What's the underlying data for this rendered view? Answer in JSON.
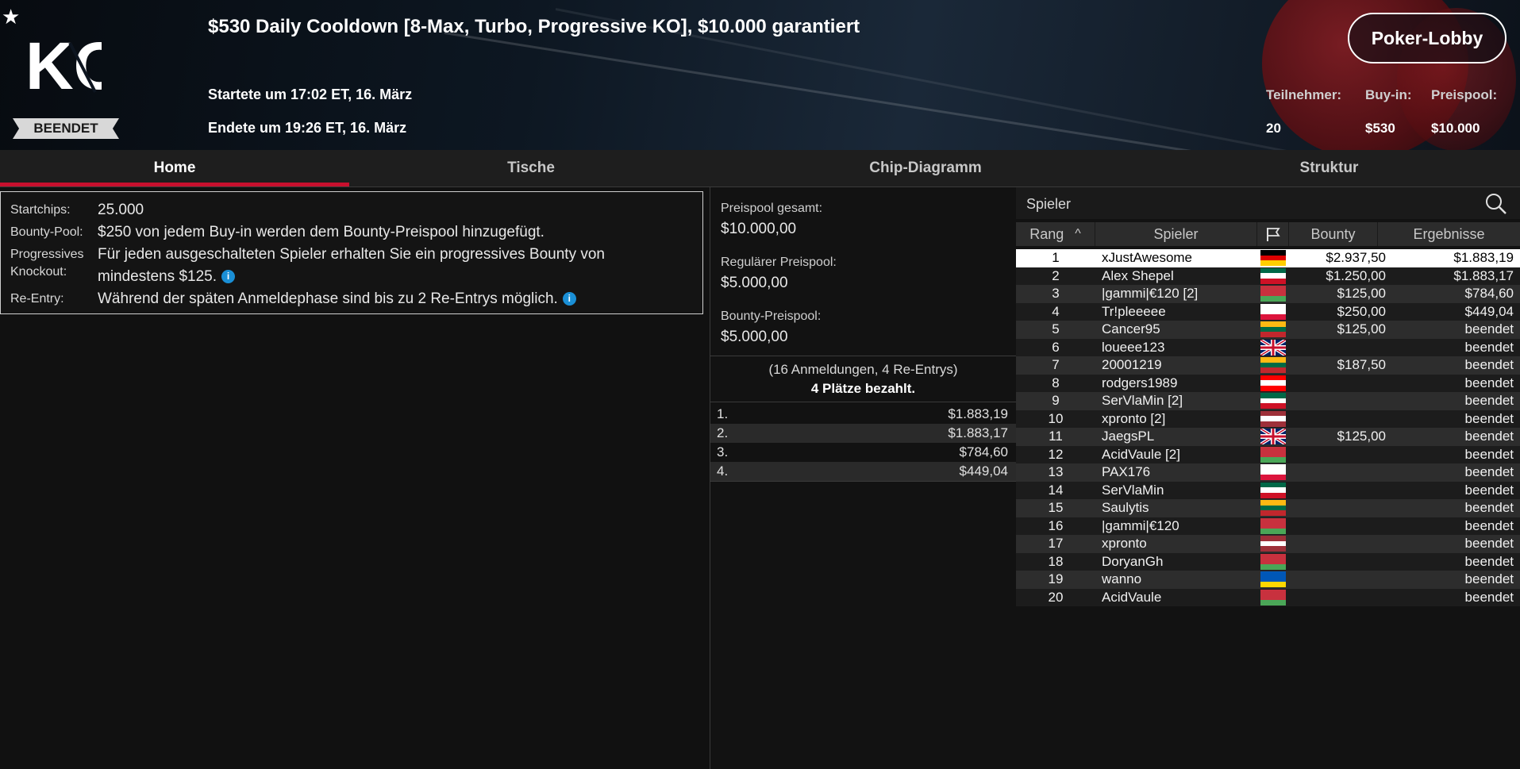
{
  "header": {
    "logo_text": "KO",
    "status_badge": "BEENDET",
    "title": "$530 Daily Cooldown [8-Max, Turbo, Progressive KO], $10.000 garantiert",
    "started": "Startete um 17:02 ET, 16. März",
    "ended": "Endete um 19:26 ET, 16. März",
    "lobby_button": "Poker-Lobby",
    "stats": [
      {
        "label": "Teilnehmer:",
        "value": "20"
      },
      {
        "label": "Buy-in:",
        "value": "$530"
      },
      {
        "label": "Preispool:",
        "value": "$10.000"
      }
    ]
  },
  "tabs": [
    "Home",
    "Tische",
    "Chip-Diagramm",
    "Struktur"
  ],
  "info": {
    "startchips_label": "Startchips:",
    "startchips_value": "25.000",
    "bounty_pool_label": "Bounty-Pool:",
    "bounty_pool_value": "$250 von jedem Buy-in werden dem Bounty-Preispool hinzugefügt.",
    "progressive_label_1": "Progressives",
    "progressive_label_2": "Knockout:",
    "progressive_value": "Für jeden ausgeschalteten Spieler erhalten Sie ein progressives Bounty von mindestens $125.",
    "reentry_label": "Re-Entry:",
    "reentry_value": "Während der späten Anmeldephase sind bis zu 2 Re-Entrys möglich."
  },
  "prizepool": {
    "total_label": "Preispool gesamt:",
    "total_value": "$10.000,00",
    "regular_label": "Regulärer Preispool:",
    "regular_value": "$5.000,00",
    "bounty_label": "Bounty-Preispool:",
    "bounty_value": "$5.000,00",
    "registrations": "(16 Anmeldungen, 4 Re-Entrys)",
    "paid_places": "4 Plätze bezahlt.",
    "payouts": [
      {
        "place": "1.",
        "amount": "$1.883,19"
      },
      {
        "place": "2.",
        "amount": "$1.883,17"
      },
      {
        "place": "3.",
        "amount": "$784,60"
      },
      {
        "place": "4.",
        "amount": "$449,04"
      }
    ]
  },
  "players": {
    "search_label": "Spieler",
    "columns": {
      "rank": "Rang",
      "player": "Spieler",
      "bounty": "Bounty",
      "result": "Ergebnisse"
    },
    "sort_indicator": "^",
    "rows": [
      {
        "rank": "1",
        "name": "xJustAwesome",
        "flag": "de",
        "bounty": "$2.937,50",
        "result": "$1.883,19"
      },
      {
        "rank": "2",
        "name": "Alex Shepel",
        "flag": "mx",
        "bounty": "$1.250,00",
        "result": "$1.883,17"
      },
      {
        "rank": "3",
        "name": "|gammi|€120 [2]",
        "flag": "by",
        "bounty": "$125,00",
        "result": "$784,60"
      },
      {
        "rank": "4",
        "name": "Tr!pleeeee",
        "flag": "pl",
        "bounty": "$250,00",
        "result": "$449,04"
      },
      {
        "rank": "5",
        "name": "Cancer95",
        "flag": "lt",
        "bounty": "$125,00",
        "result": "beendet"
      },
      {
        "rank": "6",
        "name": "loueee123",
        "flag": "gb",
        "bounty": "",
        "result": "beendet"
      },
      {
        "rank": "7",
        "name": "20001219",
        "flag": "lt",
        "bounty": "$187,50",
        "result": "beendet"
      },
      {
        "rank": "8",
        "name": "rodgers1989",
        "flag": "ca",
        "bounty": "",
        "result": "beendet"
      },
      {
        "rank": "9",
        "name": "SerVlaMin [2]",
        "flag": "mx",
        "bounty": "",
        "result": "beendet"
      },
      {
        "rank": "10",
        "name": "xpronto [2]",
        "flag": "lv",
        "bounty": "",
        "result": "beendet"
      },
      {
        "rank": "11",
        "name": "JaegsPL",
        "flag": "gb",
        "bounty": "$125,00",
        "result": "beendet"
      },
      {
        "rank": "12",
        "name": "AcidVaule [2]",
        "flag": "by",
        "bounty": "",
        "result": "beendet"
      },
      {
        "rank": "13",
        "name": "PAX176",
        "flag": "pl",
        "bounty": "",
        "result": "beendet"
      },
      {
        "rank": "14",
        "name": "SerVlaMin",
        "flag": "mx",
        "bounty": "",
        "result": "beendet"
      },
      {
        "rank": "15",
        "name": "Saulytis",
        "flag": "lt",
        "bounty": "",
        "result": "beendet"
      },
      {
        "rank": "16",
        "name": "|gammi|€120",
        "flag": "by",
        "bounty": "",
        "result": "beendet"
      },
      {
        "rank": "17",
        "name": "xpronto",
        "flag": "lv",
        "bounty": "",
        "result": "beendet"
      },
      {
        "rank": "18",
        "name": "DoryanGh",
        "flag": "by",
        "bounty": "",
        "result": "beendet"
      },
      {
        "rank": "19",
        "name": "wanno",
        "flag": "ua",
        "bounty": "",
        "result": "beendet"
      },
      {
        "rank": "20",
        "name": "AcidVaule",
        "flag": "by",
        "bounty": "",
        "result": "beendet"
      }
    ]
  },
  "colors": {
    "accent": "#c8102e",
    "info_icon": "#1a8fd6",
    "background": "#111111"
  }
}
